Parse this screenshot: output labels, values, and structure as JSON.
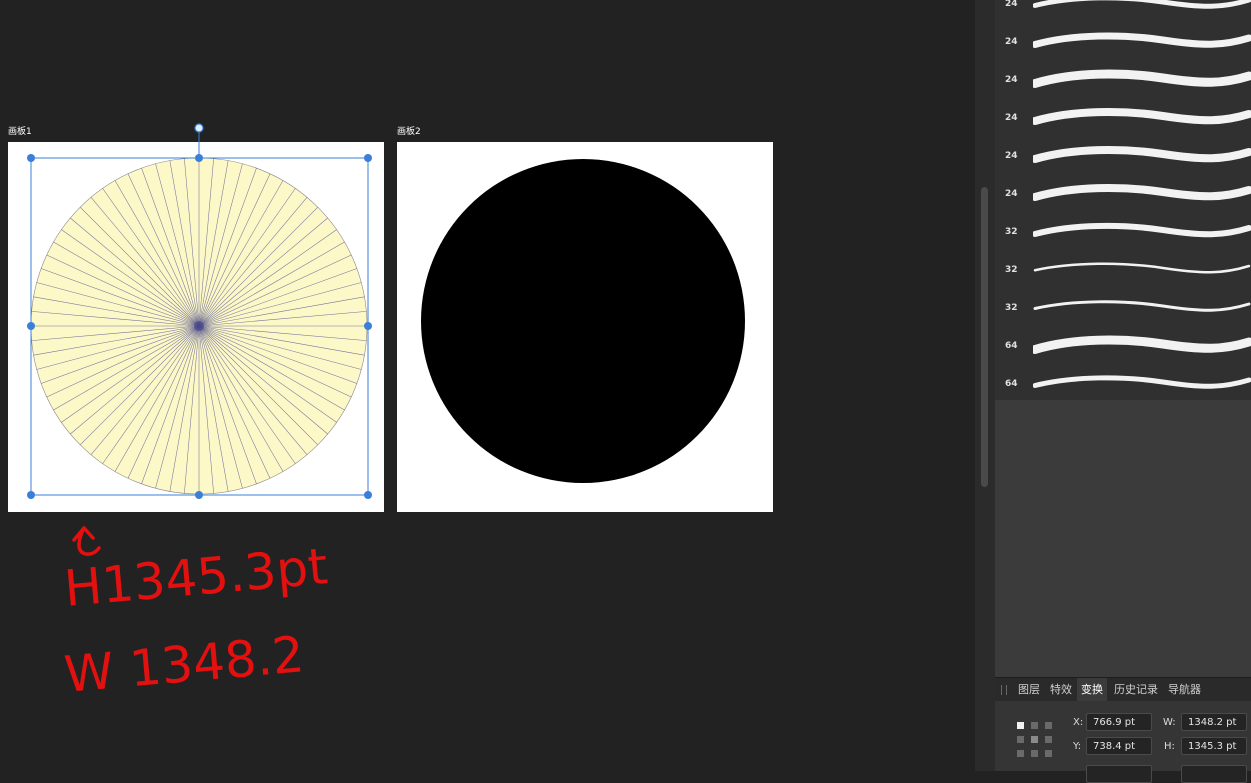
{
  "artboards": {
    "ab1_label": "画板1",
    "ab2_label": "画板2",
    "sunburst_rays": 72,
    "sunburst_fill": "#fdf8c8",
    "ray_color": "#4a4a8a",
    "disc_fill": "#000000",
    "selection_color": "#3a7fd8"
  },
  "annotation": {
    "line1": "H1345.3pt",
    "line2": "W 1348.2",
    "color": "#e31010"
  },
  "brushes": {
    "sizes": [
      "24",
      "24",
      "24",
      "24",
      "24",
      "24",
      "32",
      "32",
      "32",
      "64",
      "64"
    ]
  },
  "tabs": {
    "items": [
      "图层",
      "特效",
      "变换",
      "历史记录",
      "导航器"
    ],
    "active": "变换"
  },
  "transform": {
    "x_label": "X:",
    "x_value": "766.9 pt",
    "y_label": "Y:",
    "y_value": "738.4 pt",
    "w_label": "W:",
    "w_value": "1348.2 pt",
    "h_label": "H:",
    "h_value": "1345.3 pt"
  }
}
